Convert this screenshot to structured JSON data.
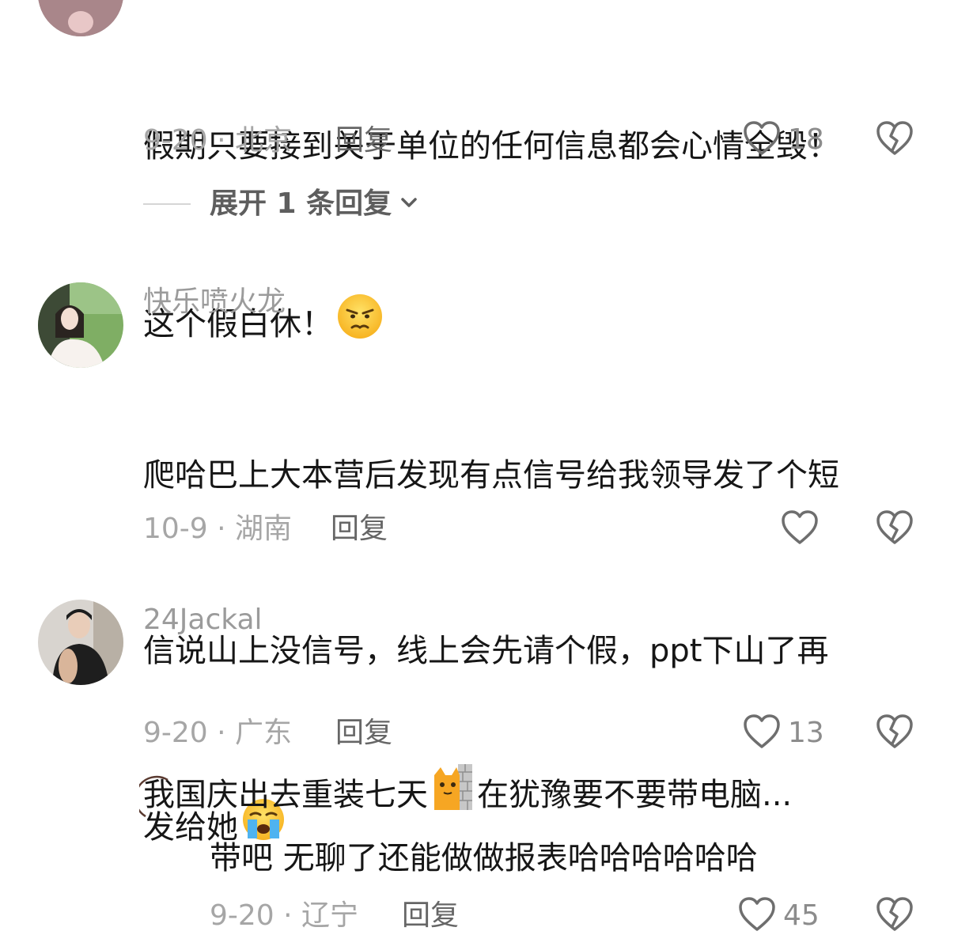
{
  "comments": [
    {
      "text_lines": [
        "假期只要接到关于单位的任何信息都会心情全毁！",
        "这个假白休！"
      ],
      "emoji_1": "unamused-face",
      "date_loc": "9-20 · 北京",
      "reply_label": "回复",
      "likes": "18",
      "expand_label": "展开 1 条回复"
    },
    {
      "username": "快乐喷火龙",
      "text_lines": [
        "爬哈巴上大本营后发现有点信号给我领导发了个短",
        "信说山上没信号，线上会先请个假，ppt下山了再",
        "发给她"
      ],
      "emoji_1": "loudly-crying-face",
      "date_loc": "10-9 · 湖南",
      "reply_label": "回复"
    },
    {
      "username": "24Jackal",
      "text_prefix": "我国庆出去重装七天",
      "text_suffix": "在犹豫要不要带电脑...",
      "emoji_1": "cat-peeking-wall",
      "date_loc": "9-20 · 广东",
      "reply_label": "回复",
      "likes": "13"
    },
    {
      "text": "带吧 无聊了还能做做报表哈哈哈哈哈哈",
      "date_loc": "9-20 · 辽宁",
      "reply_label": "回复",
      "likes": "45"
    }
  ],
  "colors": {
    "username": "#9b9b9b",
    "text": "#161616",
    "meta": "#a6a6a6",
    "icon": "#6e6e6e"
  }
}
